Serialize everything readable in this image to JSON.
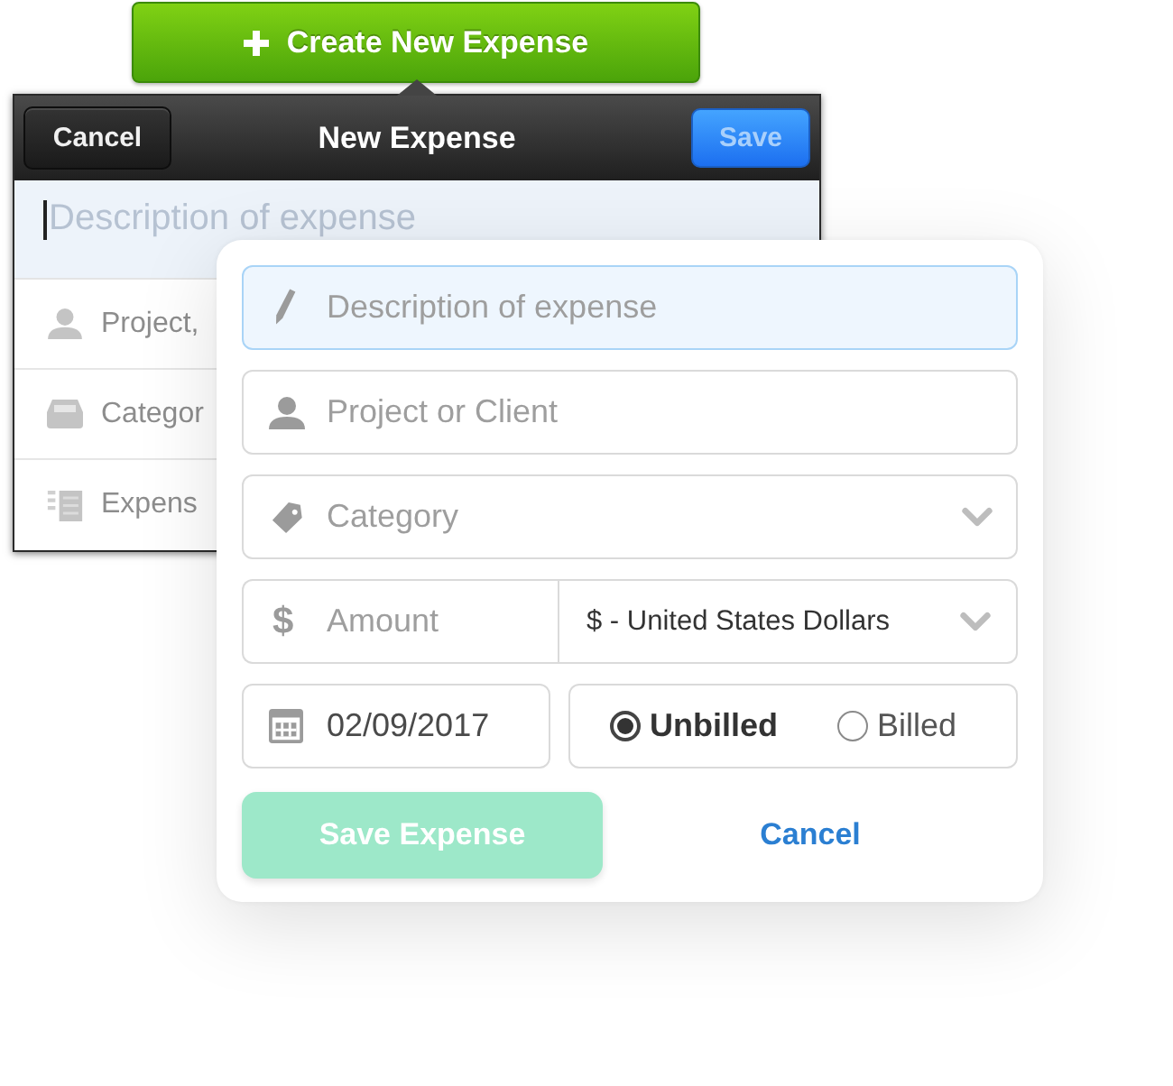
{
  "create_button": {
    "label": "Create New Expense"
  },
  "legacy_dialog": {
    "title": "New Expense",
    "cancel": "Cancel",
    "save": {
      "label": "Save",
      "disabled": true
    },
    "description": {
      "placeholder": "Description of expense",
      "focused": true
    },
    "rows": [
      {
        "label": "Project,"
      },
      {
        "label": "Categor"
      },
      {
        "label": "Expens"
      }
    ]
  },
  "form": {
    "fields": [
      {
        "kind": "text",
        "placeholder": "Description of expense",
        "focused": true
      },
      {
        "kind": "text",
        "placeholder": "Project or Client",
        "focused": false
      },
      {
        "kind": "select",
        "placeholder": "Category",
        "focused": false
      }
    ],
    "amount": {
      "symbol": "$",
      "placeholder": "Amount"
    },
    "currency": {
      "value": "$ - United States Dollars"
    },
    "date": {
      "value": "02/09/2017"
    },
    "billing": [
      {
        "label": "Unbilled",
        "selected": true
      },
      {
        "label": "Billed",
        "selected": false
      }
    ],
    "save_button": {
      "label": "Save Expense",
      "disabled": true
    },
    "cancel_link": "Cancel"
  }
}
